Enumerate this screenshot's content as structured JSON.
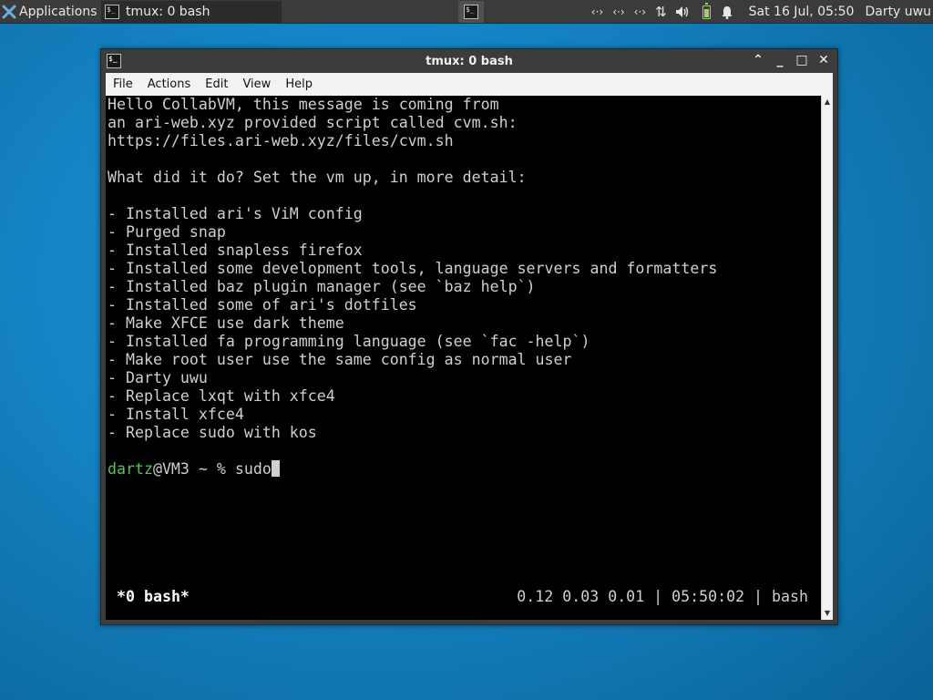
{
  "panel": {
    "applications_label": "Applications",
    "task_label": "tmux: 0 bash",
    "clock": "Sat 16 Jul, 05:50",
    "user": "Darty uwu",
    "icons": [
      "network-icon",
      "network-icon",
      "network-icon",
      "transfer-icon",
      "volume-icon",
      "battery-icon",
      "notification-bell-icon"
    ]
  },
  "window": {
    "title": "tmux: 0 bash",
    "menu": [
      "File",
      "Actions",
      "Edit",
      "View",
      "Help"
    ]
  },
  "terminal": {
    "lines": [
      "Hello CollabVM, this message is coming from",
      "an ari-web.xyz provided script called cvm.sh:",
      "https://files.ari-web.xyz/files/cvm.sh",
      "",
      "What did it do? Set the vm up, in more detail:",
      "",
      "- Installed ari's ViM config",
      "- Purged snap",
      "- Installed snapless firefox",
      "- Installed some development tools, language servers and formatters",
      "- Installed baz plugin manager (see `baz help`)",
      "- Installed some of ari's dotfiles",
      "- Make XFCE use dark theme",
      "- Installed fa programming language (see `fac -help`)",
      "- Make root user use the same config as normal user",
      "- Darty uwu",
      "- Replace lxqt with xfce4",
      "- Install xfce4",
      "- Replace sudo with kos"
    ],
    "prompt_user": "dartz",
    "prompt_rest": "@VM3 ~ % ",
    "command": "sudo",
    "status_left": "*0 bash*",
    "status_right": "0.12 0.03 0.01 | 05:50:02 | bash"
  },
  "colors": {
    "terminal_bg": "#000000",
    "terminal_fg": "#cfcfcf",
    "prompt_user": "#4ec94e",
    "panel_bg": "#3b3b3b",
    "desktop": "#1584c4"
  }
}
